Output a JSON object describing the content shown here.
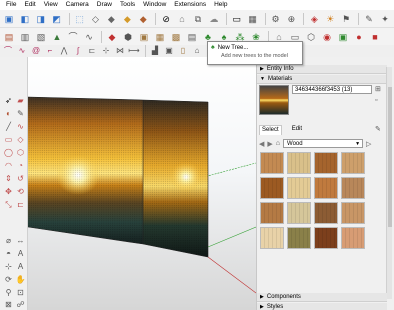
{
  "menu": [
    "File",
    "Edit",
    "View",
    "Camera",
    "Draw",
    "Tools",
    "Window",
    "Extensions",
    "Help"
  ],
  "tooltip": {
    "title": "New Tree...",
    "description": "Add new trees to the model"
  },
  "tray": {
    "entity_info": "Entity Info",
    "materials": "Materials",
    "components": "Components",
    "styles": "Styles",
    "material_name": "346344366f3453 (13)",
    "tab_select": "Select",
    "tab_edit": "Edit",
    "library": "Wood",
    "swatches": [
      "#c38a52",
      "#d9c08a",
      "#a5642d",
      "#cd9f6b",
      "#9c5a22",
      "#e3cb95",
      "#c07a3e",
      "#b8875a",
      "#b47a44",
      "#d5c69a",
      "#8c5c34",
      "#c89666",
      "#e8d2a8",
      "#8a8049",
      "#7c3f1c",
      "#d79c74"
    ]
  },
  "colors": {
    "accent_blue": "#2f6fc6",
    "axis_green": "#33a033",
    "axis_red": "#c03030"
  }
}
